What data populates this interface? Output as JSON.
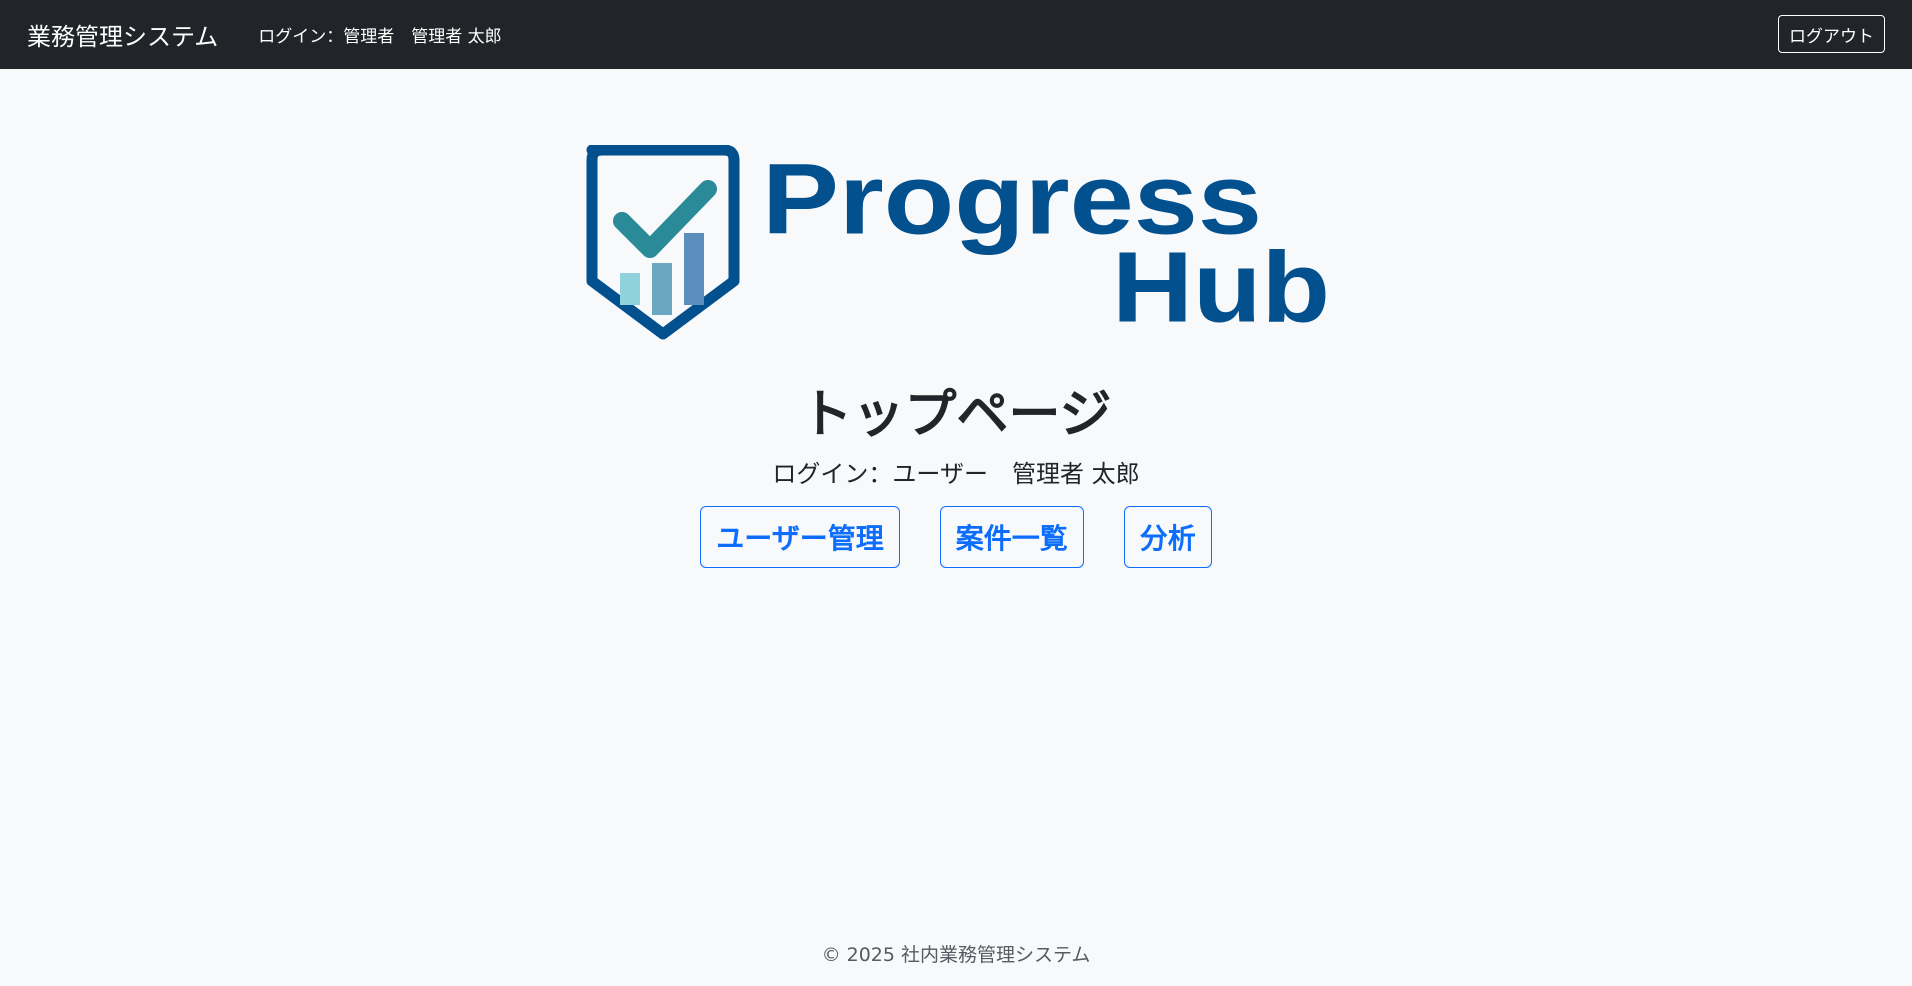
{
  "navbar": {
    "brand": "業務管理システム",
    "user_text": "ログイン：管理者　管理者 太郎",
    "logout_label": "ログアウト"
  },
  "logo": {
    "word1": "Progress",
    "word2": "Hub",
    "colors": {
      "primary": "#03508f",
      "check": "#2a8a98",
      "bar1": "#8fd1dc",
      "bar2": "#6aa8c1",
      "bar3": "#5b8ebd"
    }
  },
  "main": {
    "title": "トップページ",
    "login_info": "ログイン：ユーザー　管理者 太郎",
    "buttons": [
      {
        "label": "ユーザー管理"
      },
      {
        "label": "案件一覧"
      },
      {
        "label": "分析"
      }
    ]
  },
  "footer": {
    "text": "© 2025 社内業務管理システム"
  },
  "colors": {
    "navbar_bg": "#212529",
    "page_bg": "#f8f9fa",
    "accent": "#0d6efd"
  }
}
